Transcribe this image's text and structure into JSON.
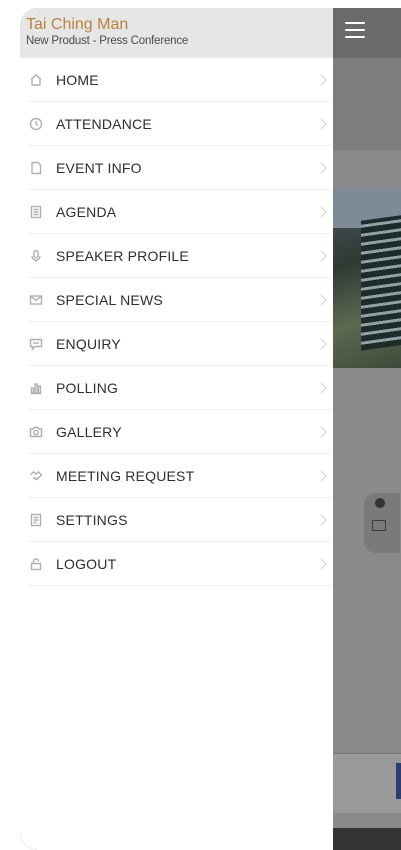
{
  "drawer": {
    "user_name": "Tai Ching Man",
    "event_name": "New Produst - Press Conference"
  },
  "menu": [
    {
      "label": "HOME",
      "icon": "home-icon"
    },
    {
      "label": "ATTENDANCE",
      "icon": "clock-icon"
    },
    {
      "label": "EVENT INFO",
      "icon": "document-icon"
    },
    {
      "label": "AGENDA",
      "icon": "agenda-icon"
    },
    {
      "label": "SPEAKER PROFILE",
      "icon": "microphone-icon"
    },
    {
      "label": "SPECIAL NEWS",
      "icon": "mail-icon"
    },
    {
      "label": "ENQUIRY",
      "icon": "chat-icon"
    },
    {
      "label": "POLLING",
      "icon": "bar-chart-icon"
    },
    {
      "label": "GALLERY",
      "icon": "camera-icon"
    },
    {
      "label": "MEETING REQUEST",
      "icon": "handshake-icon"
    },
    {
      "label": "SETTINGS",
      "icon": "settings-icon"
    },
    {
      "label": "LOGOUT",
      "icon": "lock-icon"
    }
  ],
  "colors": {
    "accent": "#b8833c",
    "header_bg": "#e6e6e6",
    "overlay": "#6e6e6e"
  }
}
